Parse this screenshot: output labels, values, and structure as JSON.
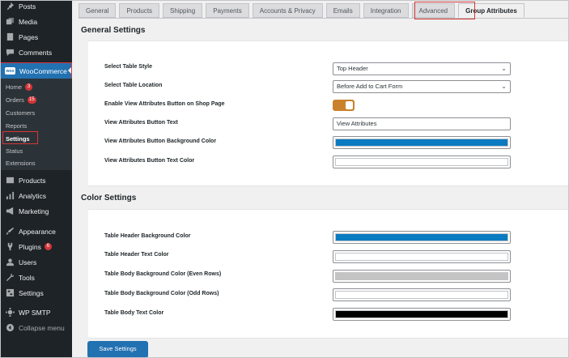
{
  "sidebar": {
    "items": [
      {
        "label": "Posts",
        "icon": "pin-icon"
      },
      {
        "label": "Media",
        "icon": "media-icon"
      },
      {
        "label": "Pages",
        "icon": "pages-icon"
      },
      {
        "label": "Comments",
        "icon": "comments-icon"
      }
    ],
    "woocommerce": {
      "label": "WooCommerce",
      "icon_text": "woo"
    },
    "submenu": [
      {
        "label": "Home",
        "badge": "3"
      },
      {
        "label": "Orders",
        "badge": "15"
      },
      {
        "label": "Customers"
      },
      {
        "label": "Reports"
      },
      {
        "label": "Settings"
      },
      {
        "label": "Status"
      },
      {
        "label": "Extensions"
      }
    ],
    "items2": [
      {
        "label": "Products",
        "icon": "products-icon"
      },
      {
        "label": "Analytics",
        "icon": "analytics-icon"
      },
      {
        "label": "Marketing",
        "icon": "marketing-icon"
      },
      {
        "label": "Appearance",
        "icon": "appearance-icon"
      },
      {
        "label": "Plugins",
        "icon": "plugins-icon",
        "badge": "6"
      },
      {
        "label": "Users",
        "icon": "users-icon"
      },
      {
        "label": "Tools",
        "icon": "tools-icon"
      },
      {
        "label": "Settings",
        "icon": "settings-icon"
      },
      {
        "label": "WP SMTP",
        "icon": "smtp-icon"
      },
      {
        "label": "Collapse menu",
        "icon": "collapse-icon"
      }
    ]
  },
  "tabs": [
    "General",
    "Products",
    "Shipping",
    "Payments",
    "Accounts & Privacy",
    "Emails",
    "Integration",
    "Advanced",
    "Group Attributes"
  ],
  "general": {
    "title": "General Settings",
    "rows": {
      "table_style": {
        "label": "Select Table Style",
        "value": "Top Header"
      },
      "table_location": {
        "label": "Select Table Location",
        "value": "Before Add to Cart Form"
      },
      "enable_button": {
        "label": "Enable View Attributes Button on Shop Page",
        "checked": true
      },
      "button_text": {
        "label": "View Attributes Button Text",
        "value": "View Attributes"
      },
      "button_bg": {
        "label": "View Attributes Button Background Color",
        "color": "#0a7bc0"
      },
      "button_text_color": {
        "label": "View Attributes Button Text Color",
        "color": "#ffffff"
      }
    }
  },
  "color": {
    "title": "Color Settings",
    "rows": {
      "header_bg": {
        "label": "Table Header Background Color",
        "color": "#0a7bc0"
      },
      "header_text": {
        "label": "Table Header Text Color",
        "color": "#ffffff"
      },
      "body_even": {
        "label": "Table Body Background Color (Even Rows)",
        "color": "#c4c4c4"
      },
      "body_odd": {
        "label": "Table Body Background Color (Odd Rows)",
        "color": "#ffffff"
      },
      "body_text": {
        "label": "Table Body Text Color",
        "color": "#000000"
      }
    }
  },
  "save_label": "Save Settings",
  "colors": {
    "accent": "#2271b1",
    "highlight": "#d63638",
    "toggle": "#c9822b"
  }
}
